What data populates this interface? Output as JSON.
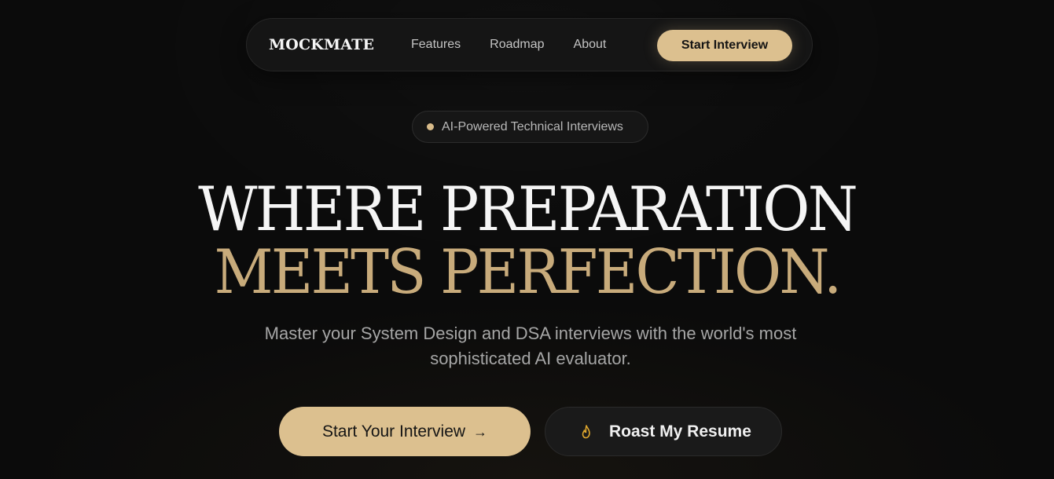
{
  "nav": {
    "brand": "MOCKMATE",
    "links": [
      "Features",
      "Roadmap",
      "About"
    ],
    "cta_label": "Start Interview"
  },
  "badge": {
    "text": "AI-Powered Technical Interviews"
  },
  "hero": {
    "line1": "WHERE PREPARATION",
    "line2": "MEETS PERFECTION.",
    "subtitle": "Master your System Design and DSA interviews with the world's most sophisticated AI evaluator."
  },
  "actions": {
    "primary_label": "Start Your Interview",
    "primary_icon": "arrow-right-icon",
    "secondary_label": "Roast My Resume",
    "secondary_icon": "flame-icon"
  },
  "colors": {
    "accent": "#dcc08f",
    "background": "#0b0b0b"
  }
}
